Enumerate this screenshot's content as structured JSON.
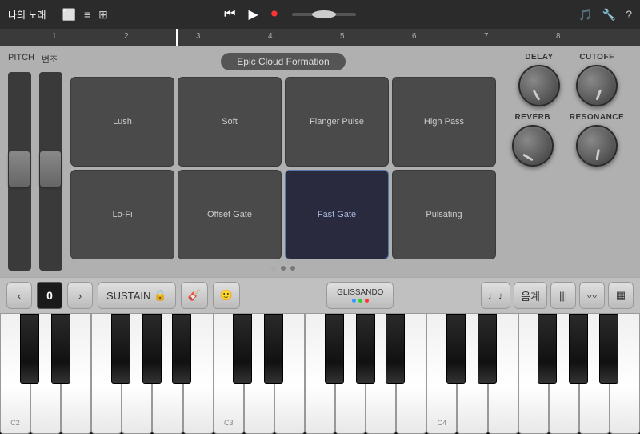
{
  "topBar": {
    "title": "나의 노래",
    "transportButtons": [
      "rewind",
      "play",
      "record"
    ],
    "rightIcons": [
      "metronome",
      "wrench",
      "help"
    ]
  },
  "ruler": {
    "markers": [
      "1",
      "2",
      "3",
      "4",
      "5",
      "6",
      "7",
      "8"
    ]
  },
  "instrument": {
    "presetName": "Epic Cloud Formation",
    "sliders": {
      "pitch": {
        "label": "PITCH"
      },
      "modulation": {
        "label": "변조"
      }
    },
    "pads": [
      {
        "id": 1,
        "label": "Lush",
        "active": false
      },
      {
        "id": 2,
        "label": "Soft",
        "active": false
      },
      {
        "id": 3,
        "label": "Flanger Pulse",
        "active": false
      },
      {
        "id": 4,
        "label": "High Pass",
        "active": false
      },
      {
        "id": 5,
        "label": "Lo-Fi",
        "active": false
      },
      {
        "id": 6,
        "label": "Offset Gate",
        "active": false
      },
      {
        "id": 7,
        "label": "Fast Gate",
        "active": true
      },
      {
        "id": 8,
        "label": "Pulsating",
        "active": false
      }
    ],
    "pageDots": [
      true,
      false,
      false
    ],
    "knobs": {
      "delay": {
        "label": "DELAY",
        "rotation": -30
      },
      "cutoff": {
        "label": "CUTOFF",
        "rotation": 20
      },
      "reverb": {
        "label": "REVERB",
        "rotation": -60
      },
      "resonance": {
        "label": "RESONANCE",
        "rotation": 10
      }
    }
  },
  "controls": {
    "octaveDown": "‹",
    "octaveValue": "0",
    "octaveUp": "›",
    "sustainLabel": "SUSTAIN",
    "glissandoLabel": "GLISSANDO",
    "glissandoDots": [
      "#3399ff",
      "#33cc33",
      "#ff3333"
    ],
    "rightButtons": [
      "note-icon",
      "scale-icon",
      "keyboard-icon",
      "arp-icon",
      "plugin-icon"
    ]
  },
  "keyboard": {
    "noteLabels": {
      "c2": "C2",
      "c3": "C3",
      "c4": "C4"
    }
  }
}
